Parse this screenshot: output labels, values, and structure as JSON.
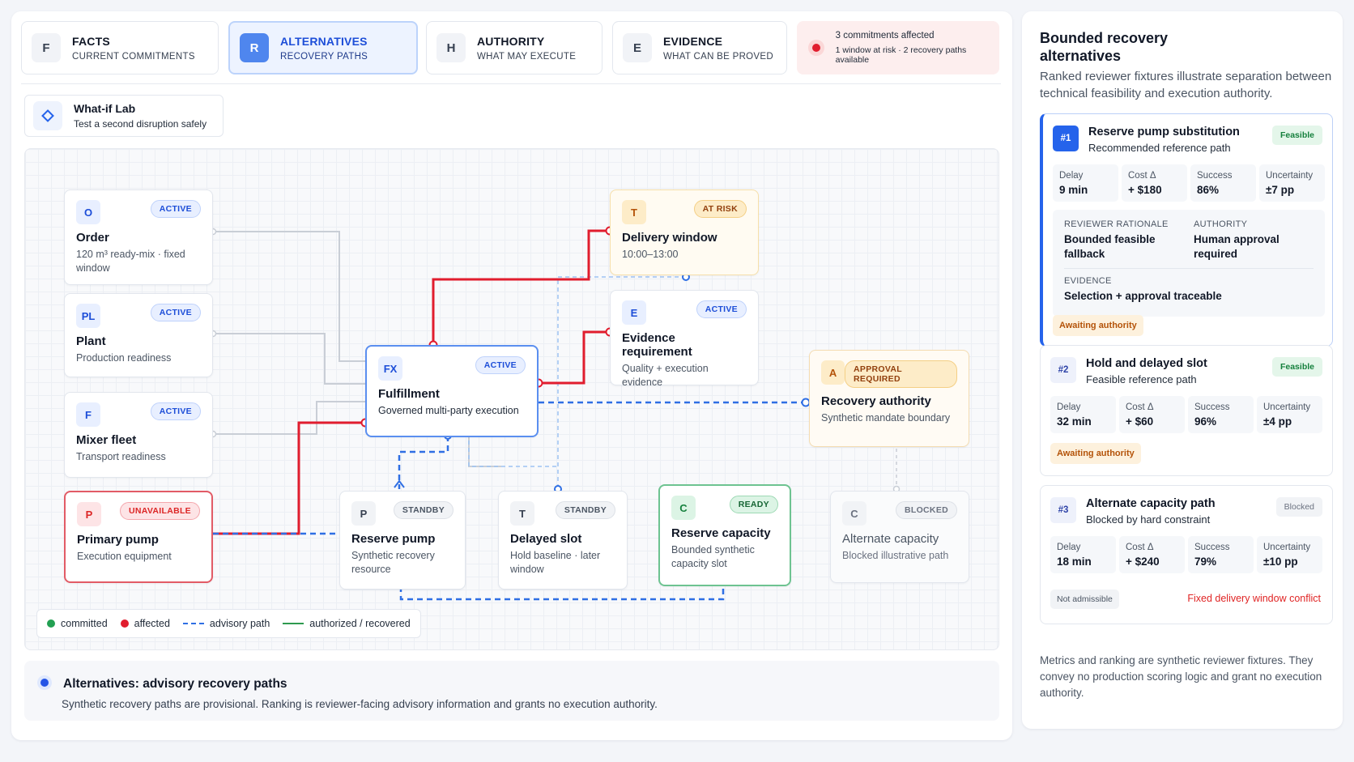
{
  "tabs": [
    {
      "letter": "F",
      "title": "FACTS",
      "sub": "CURRENT COMMITMENTS"
    },
    {
      "letter": "R",
      "title": "ALTERNATIVES",
      "sub": "RECOVERY PATHS"
    },
    {
      "letter": "H",
      "title": "AUTHORITY",
      "sub": "WHAT MAY EXECUTE"
    },
    {
      "letter": "E",
      "title": "EVIDENCE",
      "sub": "WHAT CAN BE PROVED"
    }
  ],
  "alert": {
    "line1": "3 commitments affected",
    "line2": "1 window at risk · 2 recovery paths available"
  },
  "whatif": {
    "title": "What-if Lab",
    "sub": "Test a second disruption safely"
  },
  "nodes": {
    "order": {
      "letter": "O",
      "badge": "ACTIVE",
      "title": "Order",
      "sub": "120 m³ ready-mix · fixed window"
    },
    "plant": {
      "letter": "PL",
      "badge": "ACTIVE",
      "title": "Plant",
      "sub": "Production readiness"
    },
    "mixer": {
      "letter": "F",
      "badge": "ACTIVE",
      "title": "Mixer fleet",
      "sub": "Transport readiness"
    },
    "pump": {
      "letter": "P",
      "badge": "UNAVAILABLE",
      "title": "Primary pump",
      "sub": "Execution equipment"
    },
    "fulfillment": {
      "letter": "FX",
      "badge": "ACTIVE",
      "title": "Fulfillment",
      "sub": "Governed multi-party execution"
    },
    "delivery": {
      "letter": "T",
      "badge": "AT RISK",
      "title": "Delivery window",
      "sub": "10:00–13:00"
    },
    "evidence": {
      "letter": "E",
      "badge": "ACTIVE",
      "title": "Evidence requirement",
      "sub": "Quality + execution evidence"
    },
    "recovery": {
      "letter": "A",
      "badge": "APPROVAL REQUIRED",
      "title": "Recovery authority",
      "sub": "Synthetic mandate boundary"
    },
    "reserve_pump": {
      "letter": "P",
      "badge": "STANDBY",
      "title": "Reserve pump",
      "sub": "Synthetic recovery resource"
    },
    "delayed": {
      "letter": "T",
      "badge": "STANDBY",
      "title": "Delayed slot",
      "sub": "Hold baseline · later window"
    },
    "reserve_cap": {
      "letter": "C",
      "badge": "READY",
      "title": "Reserve capacity",
      "sub": "Bounded synthetic capacity slot"
    },
    "alt_cap": {
      "letter": "C",
      "badge": "BLOCKED",
      "title": "Alternate capacity",
      "sub": "Blocked illustrative path"
    }
  },
  "legend": {
    "committed": "committed",
    "affected": "affected",
    "advisory": "advisory path",
    "authorized": "authorized / recovered"
  },
  "colors": {
    "committed": "#22a052",
    "affected": "#e11d2e",
    "advisory": "#2f6fe4",
    "authorized": "#2e9a4f"
  },
  "banner": {
    "title": "Alternatives: advisory recovery paths",
    "text": "Synthetic recovery paths are provisional. Ranking is reviewer-facing advisory information and grants no execution authority."
  },
  "side": {
    "title": "Bounded recovery alternatives",
    "desc": "Ranked reviewer fixtures illustrate separation between technical feasibility and execution authority.",
    "metric_labels": {
      "delay": "Delay",
      "cost": "Cost Δ",
      "success": "Success",
      "uncertainty": "Uncertainty"
    },
    "cards": [
      {
        "rank": "#1",
        "title": "Reserve pump substitution",
        "sub": "Recommended reference path",
        "pill": "Feasible",
        "delay": "9 min",
        "cost": "+ $180",
        "success": "86%",
        "uncertainty": "±7 pp",
        "rationale_label": "REVIEWER RATIONALE",
        "rationale": "Bounded feasible fallback",
        "authority_label": "AUTHORITY",
        "authority": "Human approval required",
        "evidence_label": "EVIDENCE",
        "evidence": "Selection + approval traceable",
        "status": "Awaiting authority"
      },
      {
        "rank": "#2",
        "title": "Hold and delayed slot",
        "sub": "Feasible reference path",
        "pill": "Feasible",
        "delay": "32 min",
        "cost": "+ $60",
        "success": "96%",
        "uncertainty": "±4 pp",
        "status": "Awaiting authority"
      },
      {
        "rank": "#3",
        "title": "Alternate capacity path",
        "sub": "Blocked by hard constraint",
        "pill": "Blocked",
        "delay": "18 min",
        "cost": "+ $240",
        "success": "79%",
        "uncertainty": "±10 pp",
        "status": "Not admissible",
        "conflict": "Fixed delivery window conflict"
      }
    ],
    "footer": "Metrics and ranking are synthetic reviewer fixtures. They convey no production scoring logic and grant no execution authority."
  }
}
